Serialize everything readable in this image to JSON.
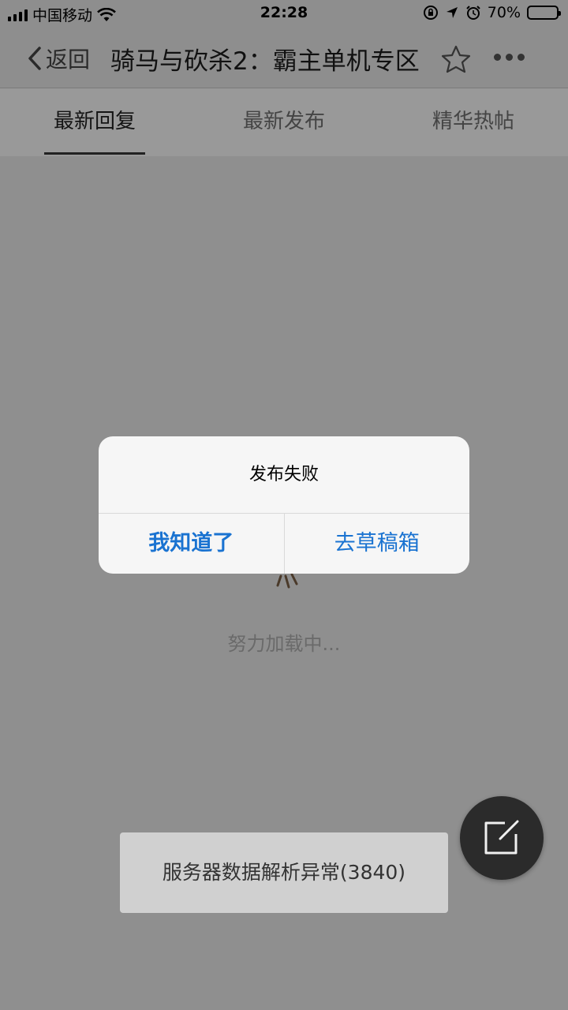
{
  "status_bar": {
    "carrier": "中国移动",
    "time": "22:28",
    "battery": "70%",
    "battery_level": 0.7
  },
  "nav": {
    "back_label": "返回",
    "title": "骑马与砍杀2：霸主单机专区"
  },
  "tabs": [
    {
      "label": "最新回复",
      "active": true
    },
    {
      "label": "最新发布",
      "active": false
    },
    {
      "label": "精华热帖",
      "active": false
    }
  ],
  "loading": {
    "text": "努力加载中..."
  },
  "alert": {
    "title": "发布失败",
    "primary_label": "我知道了",
    "secondary_label": "去草稿箱"
  },
  "toast": {
    "text": "服务器数据解析异常(3840)"
  },
  "colors": {
    "link_blue": "#1a73d1",
    "overlay_gray": "#8f8f8f"
  },
  "icons": {
    "back": "chevron-left-icon",
    "favorite": "star-icon",
    "more": "more-dots-icon",
    "compose": "compose-icon"
  }
}
